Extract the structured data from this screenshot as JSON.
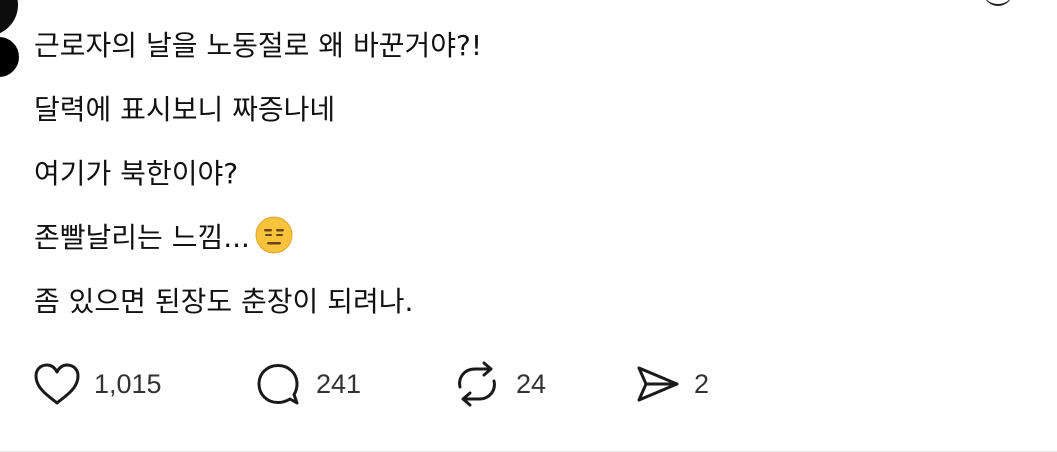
{
  "post": {
    "lines": [
      "근로자의 날을 노동절로 왜 바꾼거야?!",
      "달력에 표시보니 짜증나네",
      "여기가 북한이야?",
      "존빨날리는 느낌...",
      "좀 있으면 된장도 춘장이 되려나."
    ],
    "emoji": "expressionless-face"
  },
  "actions": {
    "like_count": "1,015",
    "comment_count": "241",
    "repost_count": "24",
    "share_count": "2"
  },
  "colors": {
    "text": "#111111",
    "count": "#333333",
    "emoji_face": "#F7C33C"
  }
}
